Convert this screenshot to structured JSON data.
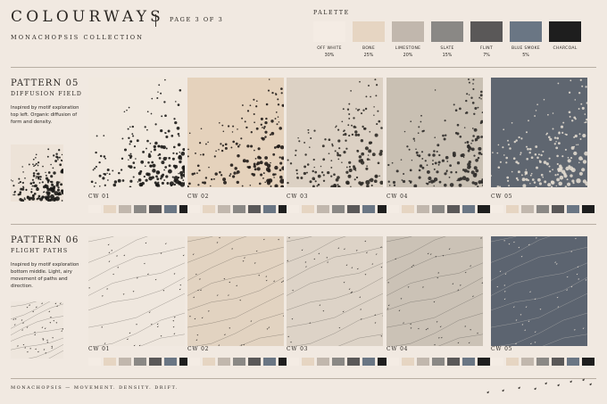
{
  "header": {
    "title": "COLOURWAYS",
    "page_indicator": "PAGE 3 OF 3",
    "subtitle": "MONACHOPSIS COLLECTION"
  },
  "palette": {
    "label": "PALETTE",
    "swatches": [
      {
        "name": "OFF WHITE",
        "percent": "30%",
        "color": "#f4ece4"
      },
      {
        "name": "BONE",
        "percent": "25%",
        "color": "#e6d5c2"
      },
      {
        "name": "LIMESTONE",
        "percent": "20%",
        "color": "#c1b7ad"
      },
      {
        "name": "SLATE",
        "percent": "15%",
        "color": "#8a8885"
      },
      {
        "name": "FLINT",
        "percent": "7%",
        "color": "#5a5858"
      },
      {
        "name": "BLUE SMOKE",
        "percent": "5%",
        "color": "#6a7684"
      },
      {
        "name": "CHARCOAL",
        "percent": "",
        "color": "#1e1e1e"
      }
    ]
  },
  "patterns": [
    {
      "title": "PATTERN 05",
      "subtitle": "DIFFUSION FIELD",
      "description": "Inspired by motif exploration top left. Organic diffusion of form and density.",
      "motif": "diffusion-dots",
      "colourways": [
        {
          "label": "CW 01",
          "bg": "#f1e9df",
          "fg": "#1a1816"
        },
        {
          "label": "CW 02",
          "bg": "#e5d2bc",
          "fg": "#201b17"
        },
        {
          "label": "CW 03",
          "bg": "#dcd1c4",
          "fg": "#2e2a26"
        },
        {
          "label": "CW 04",
          "bg": "#c9c0b3",
          "fg": "#2d2b29"
        },
        {
          "label": "CW 05",
          "bg": "#5f6670",
          "fg": "#e9e0d4"
        }
      ]
    },
    {
      "title": "PATTERN 06",
      "subtitle": "FLIGHT PATHS",
      "description": "Inspired by motif exploration bottom middle. Light, airy movement of paths and direction.",
      "motif": "flight-paths",
      "colourways": [
        {
          "label": "CW 01",
          "bg": "#efe7de",
          "fg": "#3a3530"
        },
        {
          "label": "CW 02",
          "bg": "#e2d3c1",
          "fg": "#3a3430"
        },
        {
          "label": "CW 03",
          "bg": "#ddd3c7",
          "fg": "#3d3935"
        },
        {
          "label": "CW 04",
          "bg": "#cbc2b6",
          "fg": "#3a3836"
        },
        {
          "label": "CW 05",
          "bg": "#5c6470",
          "fg": "#e7dfd4"
        }
      ]
    }
  ],
  "strip_colors": [
    "#f4ece4",
    "#e6d5c2",
    "#c1b7ad",
    "#8a8885",
    "#5a5858",
    "#6a7684",
    "#1e1e1e"
  ],
  "footer": "MONACHOPSIS — MOVEMENT. DENSITY. DRIFT."
}
